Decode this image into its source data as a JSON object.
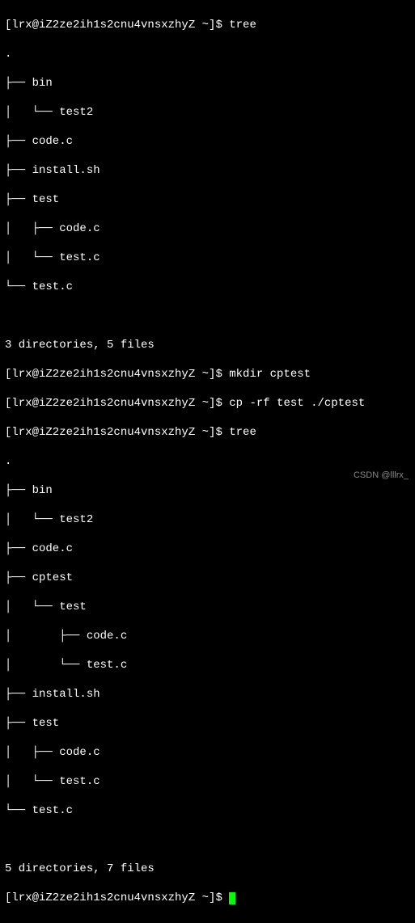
{
  "prompt": "[lrx@iZ2ze2ih1s2cnu4vnsxzhyZ ~]$ ",
  "commands": {
    "tree": "tree",
    "mkdir": "mkdir cptest",
    "cp": "cp -rf test ./cptest"
  },
  "tree1": {
    "root": ".",
    "lines": [
      "├── bin",
      "│   └── test2",
      "├── code.c",
      "├── install.sh",
      "├── test",
      "│   ├── code.c",
      "│   └── test.c",
      "└── test.c"
    ],
    "summary": "3 directories, 5 files"
  },
  "tree2": {
    "root": ".",
    "lines": [
      "├── bin",
      "│   └── test2",
      "├── code.c",
      "├── cptest",
      "│   └── test",
      "│       ├── code.c",
      "│       └── test.c",
      "├── install.sh",
      "├── test",
      "│   ├── code.c",
      "│   └── test.c",
      "└── test.c"
    ],
    "summary": "5 directories, 7 files"
  },
  "watermark": "CSDN @lllrx_"
}
